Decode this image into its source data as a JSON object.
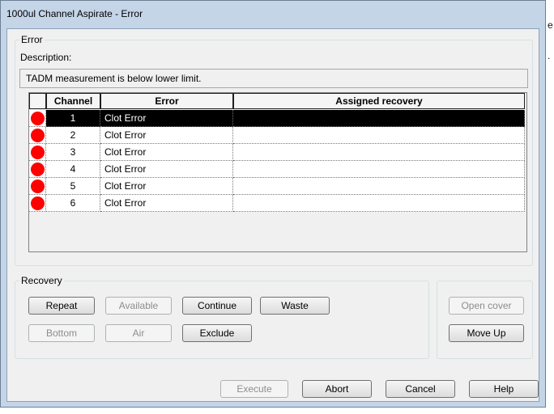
{
  "window": {
    "title": "1000ul Channel Aspirate - Error"
  },
  "error_group": {
    "legend": "Error",
    "description_label": "Description:",
    "description": "TADM measurement is below lower limit."
  },
  "table": {
    "headers": {
      "channel": "Channel",
      "error": "Error",
      "recovery": "Assigned recovery"
    },
    "rows": [
      {
        "channel": "1",
        "error": "Clot Error",
        "recovery": "",
        "selected": true
      },
      {
        "channel": "2",
        "error": "Clot Error",
        "recovery": ""
      },
      {
        "channel": "3",
        "error": "Clot Error",
        "recovery": ""
      },
      {
        "channel": "4",
        "error": "Clot Error",
        "recovery": ""
      },
      {
        "channel": "5",
        "error": "Clot Error",
        "recovery": ""
      },
      {
        "channel": "6",
        "error": "Clot Error",
        "recovery": ""
      }
    ]
  },
  "recovery": {
    "legend": "Recovery",
    "repeat": "Repeat",
    "available": "Available",
    "continue": "Continue",
    "waste": "Waste",
    "bottom": "Bottom",
    "air": "Air",
    "exclude": "Exclude",
    "open_cover": "Open cover",
    "move_up": "Move Up"
  },
  "footer": {
    "execute": "Execute",
    "abort": "Abort",
    "cancel": "Cancel",
    "help": "Help"
  },
  "colors": {
    "error_marker": "#ff0000",
    "selected_row": "#000000"
  }
}
